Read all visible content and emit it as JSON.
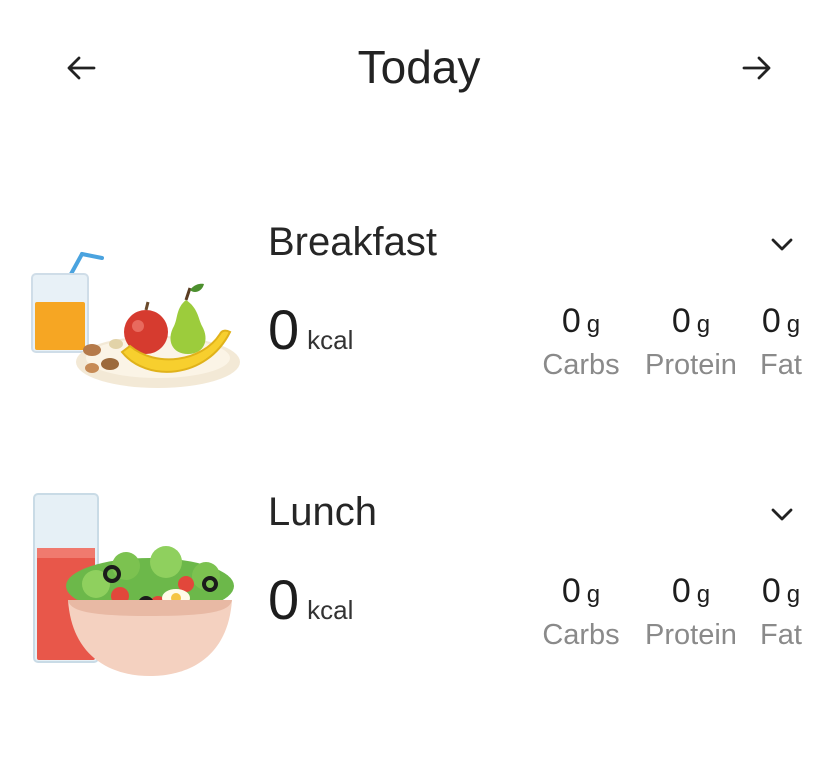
{
  "header": {
    "title": "Today",
    "prev_icon": "arrow-left-icon",
    "next_icon": "arrow-right-icon"
  },
  "meals": [
    {
      "name": "Breakfast",
      "kcal": "0",
      "kcal_unit": "kcal",
      "illustration": "breakfast-fruit-plate-juice-icon",
      "expand_icon": "chevron-down-icon",
      "macros": [
        {
          "amount": "0",
          "unit": "g",
          "label": "Carbs"
        },
        {
          "amount": "0",
          "unit": "g",
          "label": "Protein"
        },
        {
          "amount": "0",
          "unit": "g",
          "label": "Fat"
        }
      ]
    },
    {
      "name": "Lunch",
      "kcal": "0",
      "kcal_unit": "kcal",
      "illustration": "lunch-salad-bowl-juice-icon",
      "expand_icon": "chevron-down-icon",
      "macros": [
        {
          "amount": "0",
          "unit": "g",
          "label": "Carbs"
        },
        {
          "amount": "0",
          "unit": "g",
          "label": "Protein"
        },
        {
          "amount": "0",
          "unit": "g",
          "label": "Fat"
        }
      ]
    }
  ],
  "colors": {
    "text": "#1f1f1f",
    "muted": "#8a8a8a",
    "background": "#ffffff"
  }
}
